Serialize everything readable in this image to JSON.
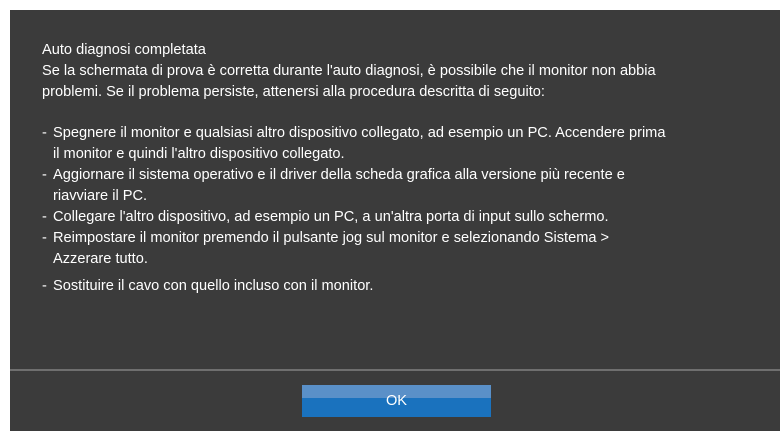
{
  "dialog": {
    "title": "Auto diagnosi completata",
    "intro_lines": [
      "Se la schermata di prova è corretta durante l'auto diagnosi, è possibile che il monitor non abbia",
      "problemi. Se il problema persiste, attenersi alla procedura descritta di seguito:"
    ],
    "steps": [
      {
        "dash": "-",
        "lines": [
          "Spegnere il monitor e qualsiasi altro dispositivo collegato, ad esempio un PC. Accendere prima",
          "il monitor e quindi l'altro dispositivo collegato."
        ]
      },
      {
        "dash": "-",
        "lines": [
          "Aggiornare il sistema operativo e il driver della scheda grafica alla versione più recente e",
          "riavviare il PC."
        ]
      },
      {
        "dash": "-",
        "lines": [
          "Collegare l'altro dispositivo, ad esempio un PC, a un'altra porta di input sullo schermo."
        ]
      },
      {
        "dash": "-",
        "lines": [
          "Reimpostare il monitor premendo il pulsante jog sul monitor e selezionando Sistema >",
          "Azzerare tutto."
        ]
      },
      {
        "dash": "-",
        "lines": [
          "Sostituire il cavo con quello incluso con il monitor."
        ]
      }
    ],
    "ok_label": "OK"
  },
  "colors": {
    "background": "#3b3b3b",
    "text": "#ffffff",
    "divider": "#6f6f6f",
    "button_top": "#5a90c8",
    "button_bottom": "#1a72be"
  }
}
